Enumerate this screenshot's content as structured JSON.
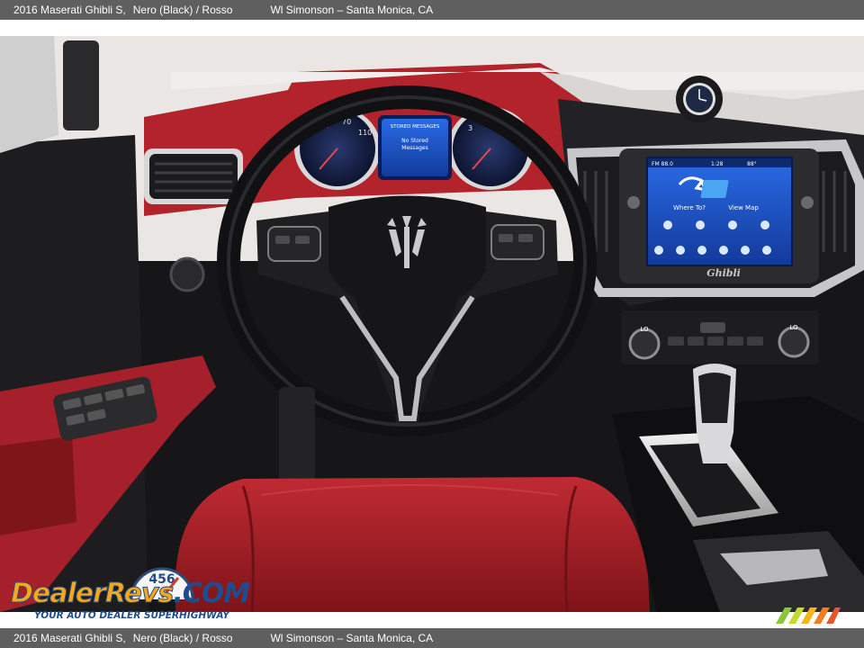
{
  "caption": {
    "vehicle": "2016 Maserati Ghibli S,",
    "color": "Nero (Black)  /  Rosso",
    "dealer": "Wl Simonson – Santa Monica, CA"
  },
  "cluster": {
    "screen_line1": "STORED MESSAGES",
    "screen_line2": "No Stored",
    "screen_line3": "Messages"
  },
  "infotainment": {
    "time": "1:28",
    "temp": "88°",
    "station": "FM 88.0",
    "tile1": "Where To?",
    "tile2": "View Map",
    "badge": "Ghibli"
  },
  "climate": {
    "left_label": "LO",
    "right_label": "LO"
  },
  "watermark": {
    "brand": "DealerRevs",
    "dotcom": ".COM",
    "tagline": "YOUR AUTO DEALER SUPERHIGHWAY",
    "gauge_digits": "456"
  },
  "colors": {
    "interior_red": "#b3232b",
    "caption_bar": "#5f5f5f",
    "screen_blue": "#1e5fd6"
  }
}
